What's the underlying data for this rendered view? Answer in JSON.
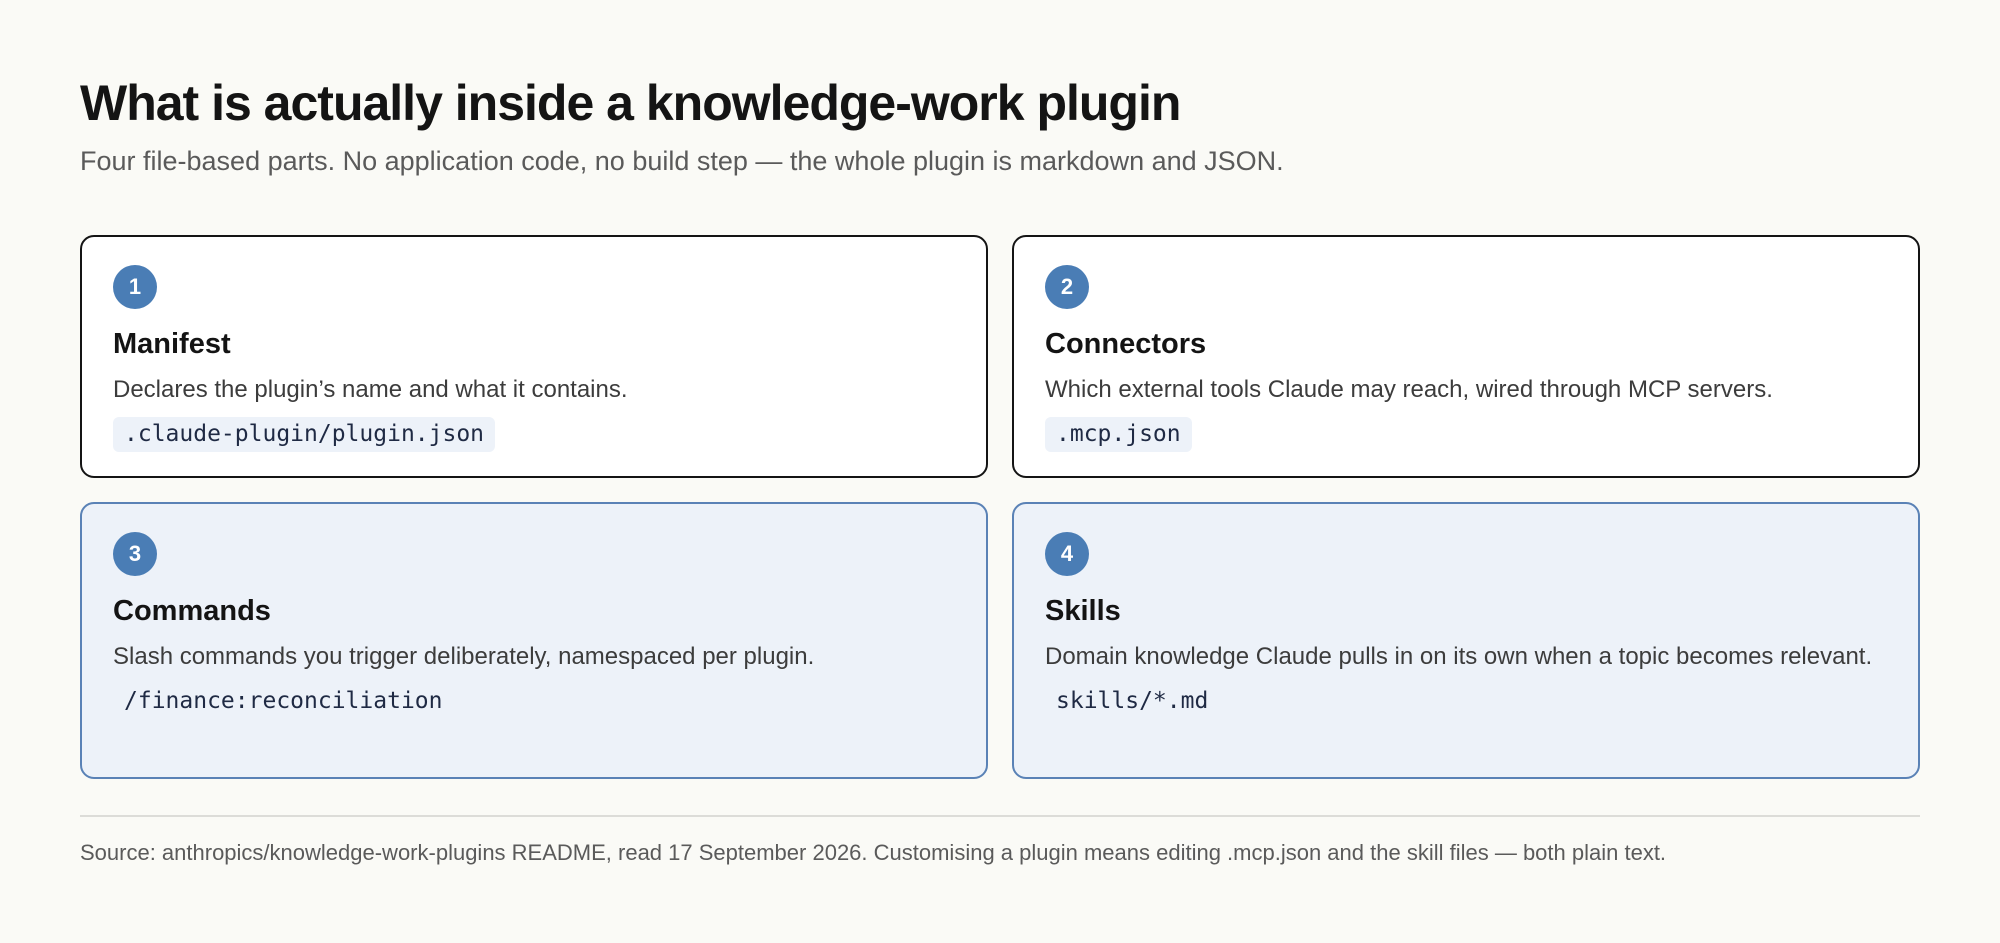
{
  "header": {
    "title": "What is actually inside a knowledge-work plugin",
    "subtitle": "Four file-based parts. No application code, no build step — the whole plugin is markdown and JSON."
  },
  "parts": [
    {
      "number": "1",
      "title": "Manifest",
      "description": "Declares the plugin’s name and what it contains.",
      "code": ".claude-plugin/plugin.json"
    },
    {
      "number": "2",
      "title": "Connectors",
      "description": "Which external tools Claude may reach, wired through MCP servers.",
      "code": ".mcp.json"
    },
    {
      "number": "3",
      "title": "Commands",
      "description": "Slash commands you trigger deliberately, namespaced per plugin.",
      "code": "/finance:reconciliation"
    },
    {
      "number": "4",
      "title": "Skills",
      "description": "Domain knowledge Claude pulls in on its own when a topic becomes relevant.",
      "code": "skills/*.md"
    }
  ],
  "footer": {
    "source": "Source: anthropics/knowledge-work-plugins README, read 17 September 2026. Customising a plugin means editing .mcp.json and the skill files — both plain text."
  },
  "colors": {
    "badge": "#4a7db5",
    "tinted_card_background": "#edf2f9",
    "tinted_card_border": "#5a82b6",
    "plain_card_border": "#141414",
    "page_background": "#fafaf6"
  }
}
